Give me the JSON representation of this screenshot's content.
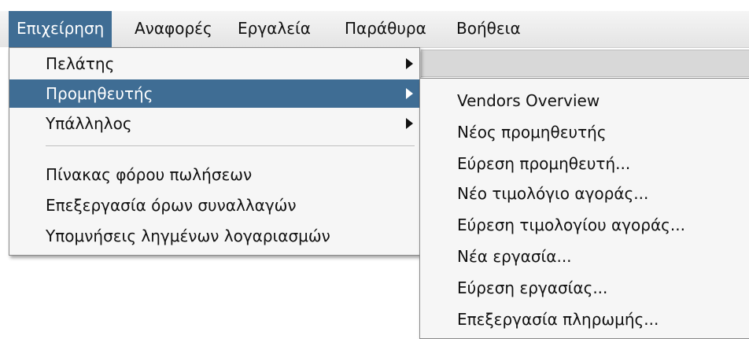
{
  "menubar": {
    "items": [
      {
        "label": "Επιχείρηση",
        "active": true
      },
      {
        "label": "Αναφορές",
        "active": false
      },
      {
        "label": "Εργαλεία",
        "active": false
      },
      {
        "label": "Παράθυρα",
        "active": false
      },
      {
        "label": "Βοήθεια",
        "active": false
      }
    ]
  },
  "main_menu": {
    "items": [
      {
        "label": "Πελάτης",
        "has_submenu": true,
        "active": false
      },
      {
        "label": "Προμηθευτής",
        "has_submenu": true,
        "active": true
      },
      {
        "label": "Υπάλληλος",
        "has_submenu": true,
        "active": false
      },
      {
        "label": "Πίνακας φόρου πωλήσεων",
        "has_submenu": false,
        "active": false
      },
      {
        "label": "Επεξεργασία όρων συναλλαγών",
        "has_submenu": false,
        "active": false
      },
      {
        "label": "Υπομνήσεις ληγμένων λογαριασμών",
        "has_submenu": false,
        "active": false
      }
    ]
  },
  "submenu": {
    "items": [
      {
        "label": "Vendors Overview"
      },
      {
        "label": "Νέος προμηθευτής"
      },
      {
        "label": "Εύρεση προμηθευτή..."
      },
      {
        "label": "Νέο τιμολόγιο αγοράς..."
      },
      {
        "label": "Εύρεση τιμολογίου αγοράς..."
      },
      {
        "label": "Νέα εργασία..."
      },
      {
        "label": "Εύρεση εργασίας..."
      },
      {
        "label": "Επεξεργασία πληρωμής..."
      }
    ]
  },
  "colors": {
    "highlight": "#3f6d94",
    "menu_background": "#f6f6f6",
    "menubar_background": "#e9e9e9"
  }
}
